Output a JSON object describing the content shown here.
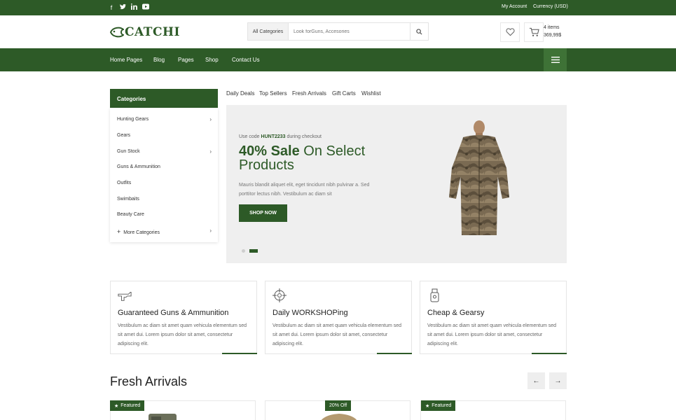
{
  "colors": {
    "primary": "#2d5a27",
    "primary_light": "#3e7236",
    "banner_bg": "#efefef"
  },
  "topbar": {
    "social": [
      "facebook-icon",
      "twitter-icon",
      "linkedin-icon",
      "youtube-icon"
    ],
    "account": "My Account",
    "currency": "Currency (USD)"
  },
  "header": {
    "logo_text": "CATCHI",
    "search_category": "All Categories",
    "search_placeholder": "Look forGuns, Accesories",
    "cart_count": "4 items",
    "cart_total": "369,99$"
  },
  "nav": {
    "items": [
      "Home Pages",
      "Blog",
      "Pages",
      "Shop",
      "Contact Us"
    ]
  },
  "sidebar": {
    "title": "Categories",
    "items": [
      {
        "label": "Hunting Gears"
      },
      {
        "label": "Gears"
      },
      {
        "label": "Gun Stock"
      },
      {
        "label": "Guns & Ammunition"
      },
      {
        "label": "Outfits"
      },
      {
        "label": "Swimbaits"
      },
      {
        "label": "Beauty Care"
      },
      {
        "label": "More Categories"
      }
    ]
  },
  "tabs": [
    "Daily Deals",
    "Top Sellers",
    "Fresh Arrivals",
    "Gift Carts",
    "Wishlist"
  ],
  "banner": {
    "code_prefix": "Use code",
    "code": "HUNT2233",
    "code_suffix": "during checkout",
    "sale": "40% Sale",
    "title_rest": "On Select Products",
    "description": "Mauris blandit aliquet elit, eget tincidunt nibh pulvinar a. Sed porttitor lectus nibh. Vestibulum ac diam sit",
    "button": "SHOP NOW"
  },
  "features": [
    {
      "title": "Guaranteed Guns & Ammunition",
      "text": "Vestibulum ac diam sit amet quam vehicula elementum sed sit amet dui. Lorem ipsum dolor sit amet, consectetur adipiscing elit."
    },
    {
      "title": "Daily WORKSHOPing",
      "text": "Vestibulum ac diam sit amet quam vehicula elementum sed sit amet dui. Lorem ipsum dolor sit amet, consectetur adipiscing elit."
    },
    {
      "title": "Cheap & Gearsy",
      "text": "Vestibulum ac diam sit amet quam vehicula elementum sed sit amet dui. Lorem ipsum dolor sit amet, consectetur adipiscing elit."
    }
  ],
  "fresh_arrivals": {
    "title": "Fresh Arrivals",
    "badges": [
      "Featured",
      "20% Off",
      "Featured"
    ]
  }
}
